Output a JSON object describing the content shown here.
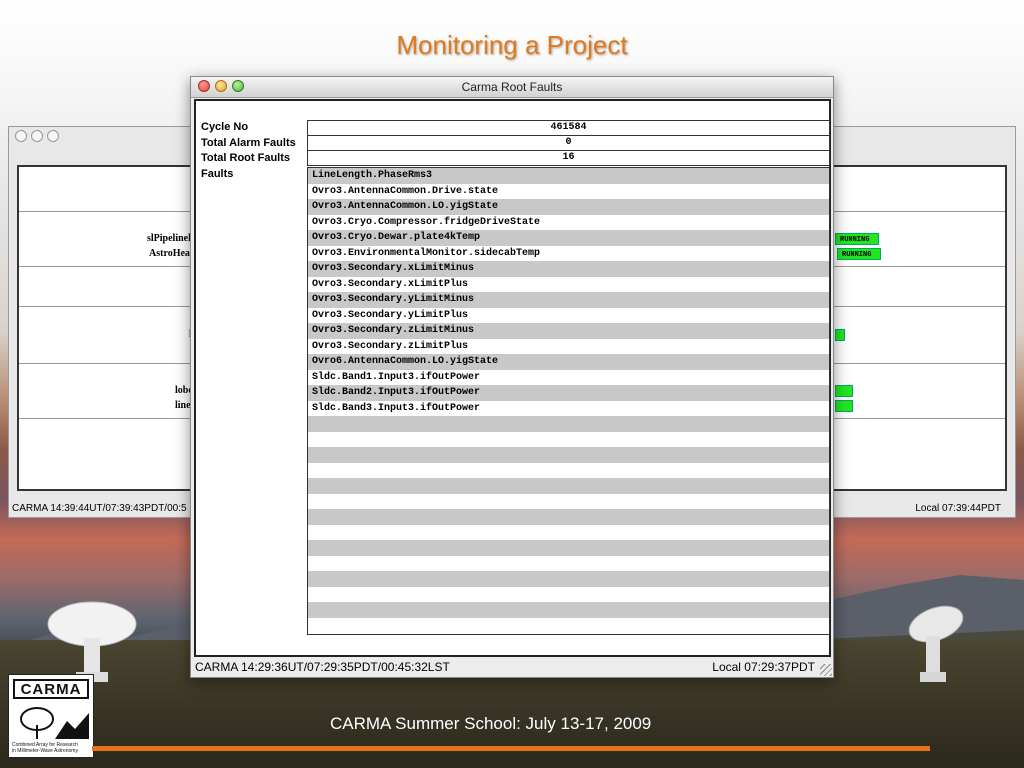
{
  "slide": {
    "title": "Monitoring a Project",
    "footer": "CARMA Summer School: July 13-17, 2009",
    "logo_name": "CARMA",
    "logo_tagline_1": "Combined Array for Research",
    "logo_tagline_2": "in Millimeter-Wave Astronomy"
  },
  "background_window": {
    "labels": [
      "slPipelinel",
      "AstroHead",
      "l",
      "lobe",
      "linel"
    ],
    "running": [
      "RUNNING",
      "RUNNING"
    ],
    "status_left": "CARMA 14:39:44UT/07:39:43PDT/00:5",
    "status_right": "Local 07:39:44PDT"
  },
  "window": {
    "title": "Carma Root Faults",
    "fields": {
      "cycle_no_label": "Cycle No",
      "cycle_no": "461584",
      "total_alarm_label": "Total Alarm Faults",
      "total_alarm": "0",
      "total_root_label": "Total Root Faults",
      "total_root": "16",
      "faults_label": "Faults"
    },
    "faults": [
      "LineLength.PhaseRms3",
      "Ovro3.AntennaCommon.Drive.state",
      "Ovro3.AntennaCommon.LO.yigState",
      "Ovro3.Cryo.Compressor.fridgeDriveState",
      "Ovro3.Cryo.Dewar.plate4kTemp",
      "Ovro3.EnvironmentalMonitor.sidecabTemp",
      "Ovro3.Secondary.xLimitMinus",
      "Ovro3.Secondary.xLimitPlus",
      "Ovro3.Secondary.yLimitMinus",
      "Ovro3.Secondary.yLimitPlus",
      "Ovro3.Secondary.zLimitMinus",
      "Ovro3.Secondary.zLimitPlus",
      "Ovro6.AntennaCommon.LO.yigState",
      "Sldc.Band1.Input3.ifOutPower",
      "Sldc.Band2.Input3.ifOutPower",
      "Sldc.Band3.Input3.ifOutPower"
    ],
    "status_left": "CARMA 14:29:36UT/07:29:35PDT/00:45:32LST",
    "status_right": "Local 07:29:37PDT"
  },
  "colors": {
    "title_orange": "#e07a1a",
    "running_green": "#22e622",
    "row_stripe": "#c8c8c8",
    "footer_line": "#e8731a"
  }
}
